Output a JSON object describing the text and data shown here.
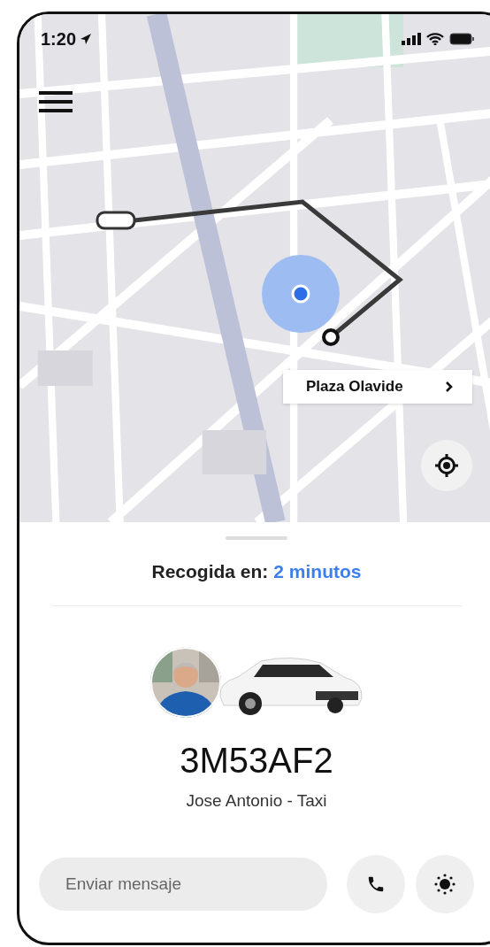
{
  "status_bar": {
    "time": "1:20"
  },
  "map": {
    "kind": "picture",
    "destination": "Plaza Olavide"
  },
  "pickup": {
    "label": "Recogida en:",
    "eta": "2 minutos"
  },
  "driver": {
    "plate": "3M53AF2",
    "name": "Jose Antonio - Taxi"
  },
  "message": {
    "placeholder": "Enviar mensaje"
  }
}
